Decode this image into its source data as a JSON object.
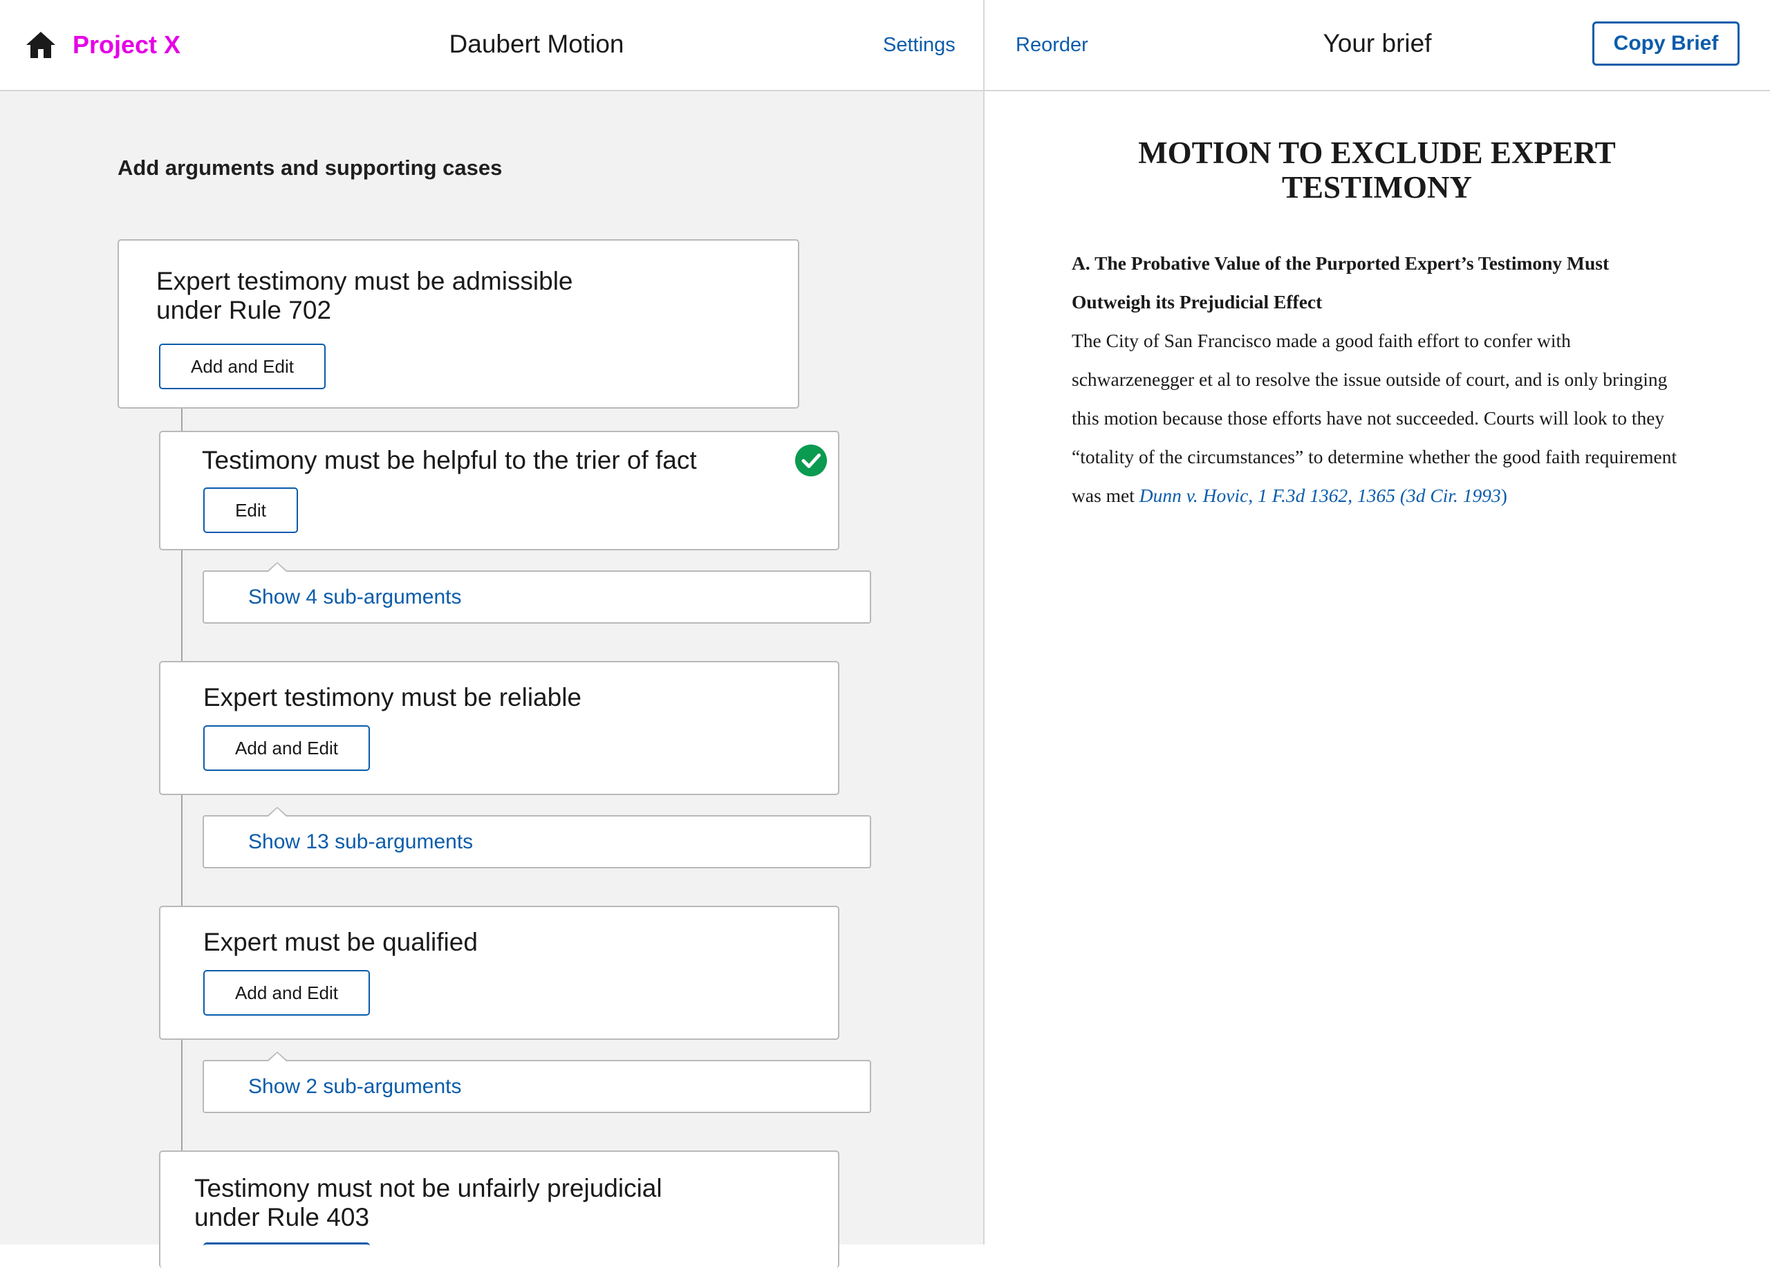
{
  "app": {
    "name": "Project X",
    "document_title": "Daubert Motion",
    "settings_label": "Settings"
  },
  "left": {
    "heading": "Add arguments and supporting cases",
    "cards": [
      {
        "title_line1": "Expert testimony must be admissible",
        "title_line2": "under Rule 702",
        "button_label": "Add and Edit"
      },
      {
        "title_line1": "Testimony must be helpful to the trier of fact",
        "button_label": "Edit",
        "status": "complete"
      },
      {
        "title_line1": "Expert testimony must be reliable",
        "button_label": "Add and Edit"
      },
      {
        "title_line1": "Expert must be qualified",
        "button_label": "Add and Edit"
      },
      {
        "title_line1": "Testimony must not be unfairly prejudicial",
        "title_line2": "under Rule 403"
      }
    ],
    "subarguments": [
      {
        "label": "Show 4 sub-arguments"
      },
      {
        "label": "Show 13 sub-arguments"
      },
      {
        "label": "Show 2 sub-arguments"
      }
    ]
  },
  "right": {
    "reorder_label": "Reorder",
    "title": "Your brief",
    "copy_label": "Copy Brief",
    "brief": {
      "heading": "MOTION TO EXCLUDE EXPERT TESTIMONY",
      "subheading": "A. The Probative Value of the Purported Expert’s Testimony Must Outweigh its Prejudicial Effect",
      "body": "The City of San Francisco made a good faith effort to confer with schwarzenegger et al to resolve the issue outside of court, and is only bringing this motion because those efforts have not succeeded. Courts will look to they “totality of the circumstances” to determine whether the good faith requirement was met ",
      "citation": "Dunn v. Hovic, 1 F.3d 1362, 1365 (3d Cir. 1993",
      "citation_close": ")"
    }
  },
  "icons": {
    "home": "home-icon",
    "complete": "check-circle-icon"
  },
  "colors": {
    "brand": "#e600e6",
    "link": "#0b5cab",
    "success": "#0a9a50",
    "panel_bg": "#f2f2f2"
  }
}
